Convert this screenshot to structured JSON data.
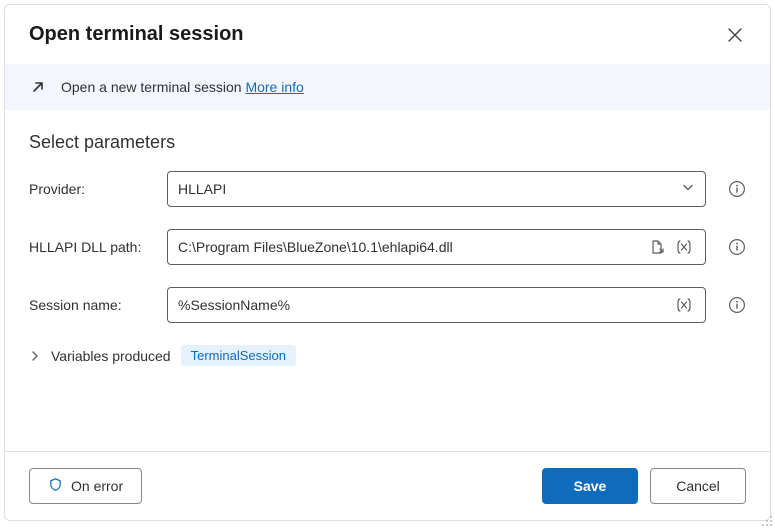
{
  "header": {
    "title": "Open terminal session"
  },
  "banner": {
    "text": "Open a new terminal session ",
    "linkText": "More info"
  },
  "section": {
    "title": "Select parameters"
  },
  "fields": {
    "provider": {
      "label": "Provider:",
      "value": "HLLAPI"
    },
    "dllPath": {
      "label": "HLLAPI DLL path:",
      "value": "C:\\Program Files\\BlueZone\\10.1\\ehlapi64.dll"
    },
    "sessionName": {
      "label": "Session name:",
      "value": "%SessionName%"
    }
  },
  "variables": {
    "label": "Variables produced",
    "chip": "TerminalSession"
  },
  "footer": {
    "onError": "On error",
    "save": "Save",
    "cancel": "Cancel"
  }
}
